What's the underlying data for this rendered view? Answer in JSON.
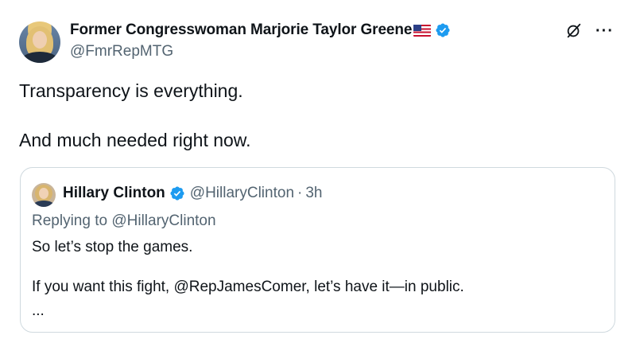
{
  "author": {
    "display_name": "Former Congresswoman Marjorie Taylor Greene",
    "flag_icon": "us-flag-icon",
    "verified_icon": "verified-badge-icon",
    "handle": "@FmrRepMTG"
  },
  "actions": {
    "grok_icon": "grok-icon",
    "more_label": "···"
  },
  "tweet": {
    "line1": "Transparency is everything.",
    "line2": "And much needed right now."
  },
  "quote": {
    "name": "Hillary Clinton",
    "handle": "@HillaryClinton",
    "separator": "·",
    "time": "3h",
    "replying_prefix": "Replying to ",
    "replying_to": "@HillaryClinton",
    "text_line1": "So let’s stop the games.",
    "text_line2": "If you want this fight, @RepJamesComer, let’s have it—in public.",
    "ellipsis": "..."
  },
  "colors": {
    "text_primary": "#0f1419",
    "text_secondary": "#536471",
    "verified_blue": "#1d9bf0",
    "border": "#cfd9de"
  }
}
